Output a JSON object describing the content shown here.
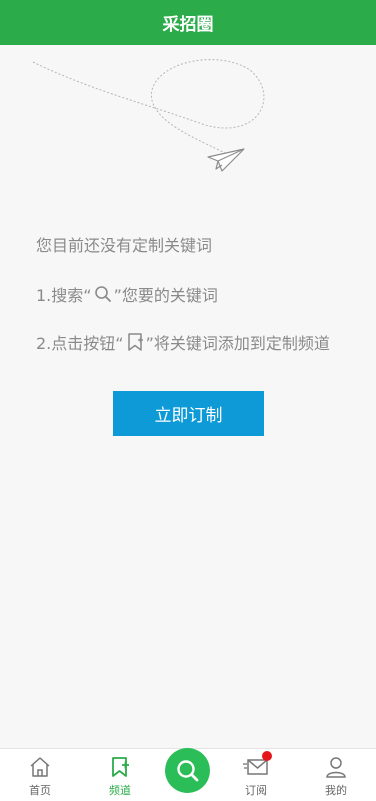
{
  "header": {
    "title": "采招圈"
  },
  "empty_state": {
    "line1": "您目前还没有定制关键词",
    "line2_prefix": "1.搜索“",
    "line2_suffix": "”您要的关键词",
    "line3_prefix": "2.点击按钮“",
    "line3_suffix": "”将关键词添加到定制频道"
  },
  "subscribe_button": {
    "label": "立即订制"
  },
  "tabbar": {
    "home": "首页",
    "channel": "频道",
    "subscribe": "订阅",
    "mine": "我的"
  },
  "colors": {
    "header_bg": "#2bab4a",
    "button_bg": "#0d9ad6",
    "active_tab": "#2bab4a",
    "badge": "#e4161c"
  },
  "icons": {
    "illustration": "paper-plane-icon",
    "search_inline": "search-icon",
    "bookmark_inline": "bookmark-add-icon",
    "home": "home-icon",
    "channel": "bookmark-add-icon",
    "center": "search-icon",
    "subscribe": "envelope-icon",
    "mine": "user-icon"
  }
}
